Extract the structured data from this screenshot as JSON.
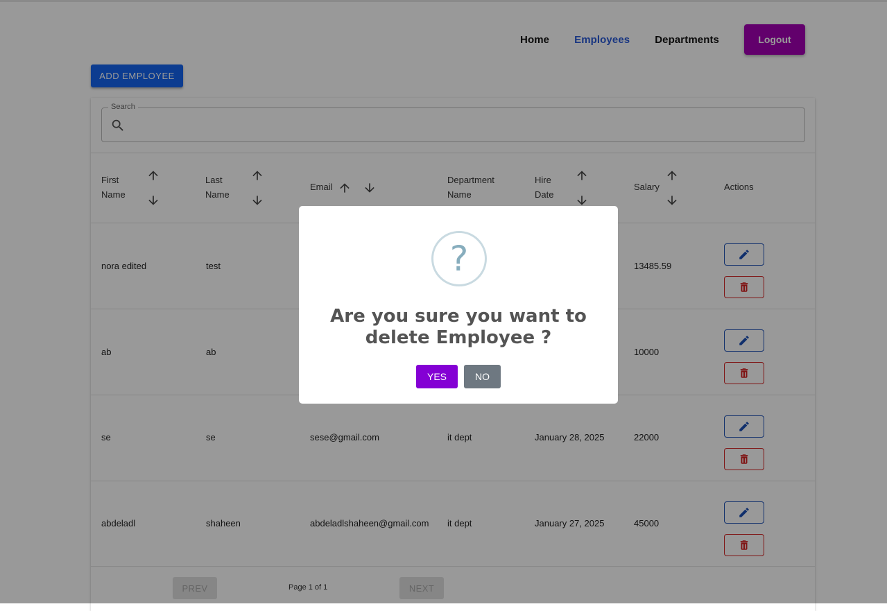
{
  "nav": {
    "home": "Home",
    "employees": "Employees",
    "departments": "Departments",
    "logout": "Logout"
  },
  "add_employee_label": "ADD EMPLOYEE",
  "search": {
    "label": "Search",
    "value": ""
  },
  "columns": {
    "first_name": [
      "First",
      "Name"
    ],
    "last_name": [
      "Last",
      "Name"
    ],
    "email": "Email",
    "department": [
      "Department",
      "Name"
    ],
    "hire_date": [
      "Hire",
      "Date"
    ],
    "salary": "Salary",
    "actions": "Actions"
  },
  "rows": [
    {
      "first": "nora edited",
      "last": "test",
      "email": "",
      "department": "",
      "hire_date": "",
      "salary": "13485.59"
    },
    {
      "first": "ab",
      "last": "ab",
      "email": "",
      "department": "",
      "hire_date": "",
      "salary": "10000"
    },
    {
      "first": "se",
      "last": "se",
      "email": "sese@gmail.com",
      "department": "it dept",
      "hire_date": "January 28, 2025",
      "salary": "22000"
    },
    {
      "first": "abdeladl",
      "last": "shaheen",
      "email": "abdeladlshaheen@gmail.com",
      "department": "it dept",
      "hire_date": "January 27, 2025",
      "salary": "45000"
    }
  ],
  "pagination": {
    "prev": "PREV",
    "info": "Page 1 of 1",
    "next": "NEXT"
  },
  "dialog": {
    "icon": "question-icon",
    "mark": "?",
    "title": "Are you sure you want to delete Employee ?",
    "yes": "YES",
    "no": "NO"
  },
  "colors": {
    "nav_active": "#2a5bd7",
    "logout_bg": "#a400b4",
    "add_button_bg": "#1565f0",
    "edit_border": "#1b4fb5",
    "delete_border": "#d42020",
    "yes_bg": "#8400d4",
    "no_bg": "#6e7881",
    "overlay": "rgba(0,0,0,0.4)"
  }
}
